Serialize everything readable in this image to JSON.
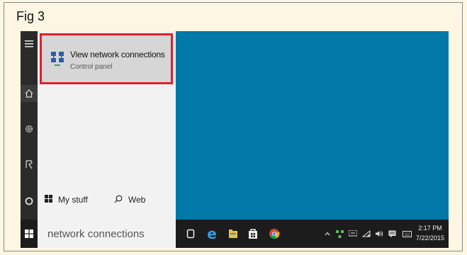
{
  "figure": {
    "label": "Fig 3"
  },
  "search_result": {
    "title": "View network connections",
    "subtitle": "Control panel"
  },
  "scopes": {
    "my_stuff": "My stuff",
    "web": "Web"
  },
  "search": {
    "query": "network connections"
  },
  "rail_icons": [
    "hamburger-icon",
    "home-icon",
    "settings-icon",
    "feedback-icon",
    "cortana-icon"
  ],
  "taskbar_icons": [
    "task-view-icon",
    "edge-icon",
    "file-explorer-icon",
    "store-icon",
    "chrome-icon"
  ],
  "tray_icons": [
    "chevron-up-icon",
    "network-icon",
    "network-2-icon",
    "wifi-icon",
    "volume-icon",
    "notifications-icon",
    "keyboard-icon"
  ],
  "clock": {
    "time": "2:17 PM",
    "date": "7/22/2015"
  },
  "colors": {
    "desktop": "#0078a8",
    "highlight_border": "#e0202a",
    "taskbar": "#1c1c1c"
  }
}
